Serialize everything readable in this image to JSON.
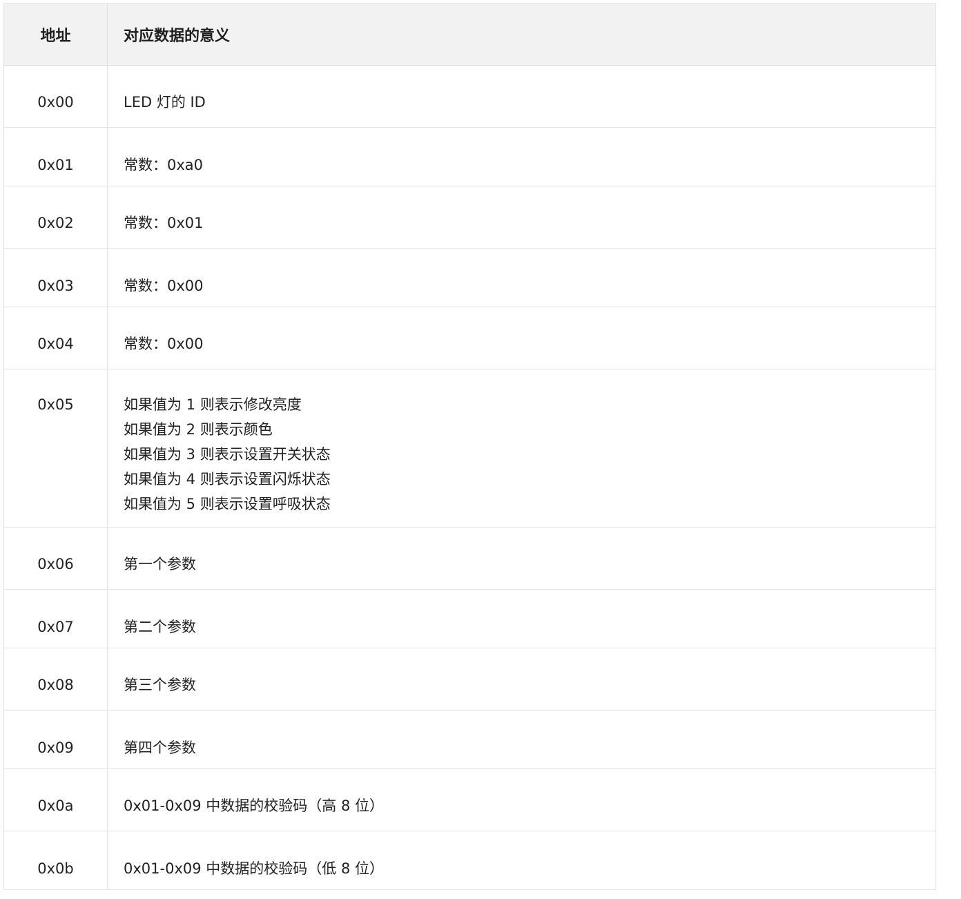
{
  "table": {
    "headers": {
      "address": "地址",
      "meaning": "对应数据的意义"
    },
    "rows": [
      {
        "address": "0x00",
        "meaning": "LED 灯的 ID"
      },
      {
        "address": "0x01",
        "meaning": "常数：0xa0"
      },
      {
        "address": "0x02",
        "meaning": "常数：0x01"
      },
      {
        "address": "0x03",
        "meaning": "常数：0x00"
      },
      {
        "address": "0x04",
        "meaning": "常数：0x00"
      },
      {
        "address": "0x05",
        "meaning_lines": [
          "如果值为 1 则表示修改亮度",
          "如果值为 2 则表示颜色",
          "如果值为 3 则表示设置开关状态",
          "如果值为 4 则表示设置闪烁状态",
          "如果值为 5 则表示设置呼吸状态"
        ]
      },
      {
        "address": "0x06",
        "meaning": "第一个参数"
      },
      {
        "address": "0x07",
        "meaning": "第二个参数"
      },
      {
        "address": "0x08",
        "meaning": "第三个参数"
      },
      {
        "address": "0x09",
        "meaning": "第四个参数"
      },
      {
        "address": "0x0a",
        "meaning": "0x01-0x09 中数据的校验码（高 8 位）"
      },
      {
        "address": "0x0b",
        "meaning": "0x01-0x09 中数据的校验码（低 8 位）"
      }
    ]
  }
}
